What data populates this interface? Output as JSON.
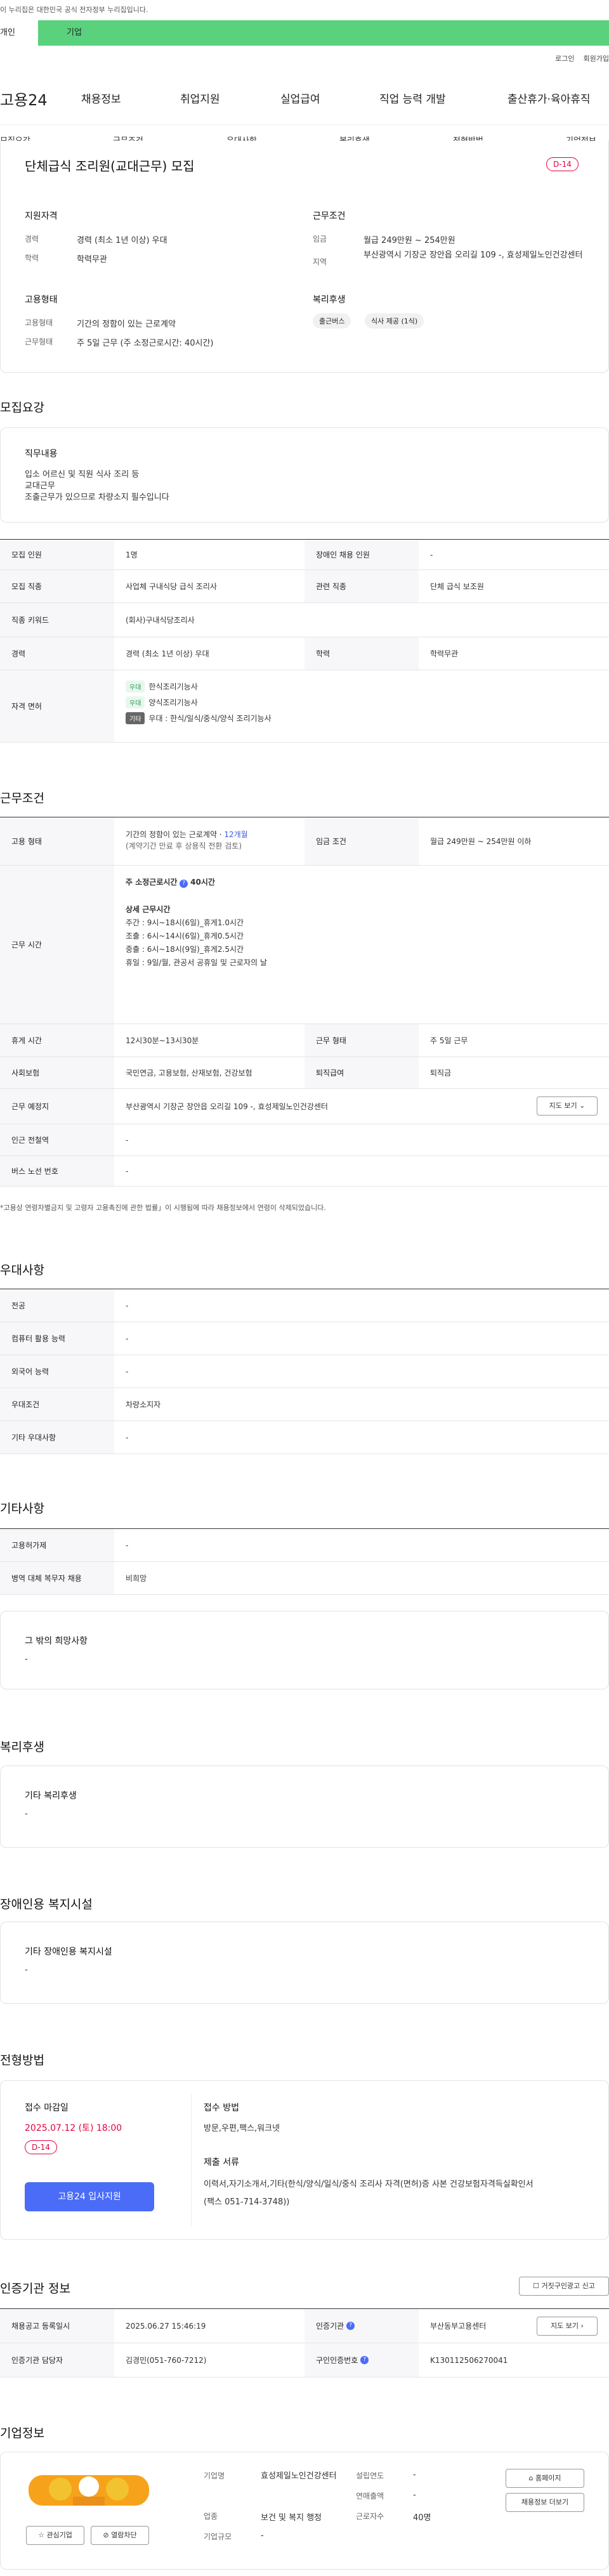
{
  "gov_banner": "이 누리집은 대한민국 공식 전자정부 누리집입니다.",
  "tabs": [
    "개인",
    "기업"
  ],
  "util": [
    "로그인",
    "회원가입"
  ],
  "logo": "고용24",
  "gnb": [
    "채용정보",
    "취업지원",
    "실업급여",
    "직업 능력 개발",
    "출산휴가·육아휴직"
  ],
  "subnav": [
    "모집요강",
    "근무조건",
    "우대사항",
    "복리후생",
    "전형방법",
    "기업정보"
  ],
  "summary": {
    "title": "단체급식 조리원(교대근무) 모집",
    "dday": "D-14",
    "qual_head": "지원자격",
    "career_lbl": "경력",
    "career": "경력 (최소 1년 이상) 우대",
    "edu_lbl": "학력",
    "edu": "학력무관",
    "cond_head": "근무조건",
    "wage_lbl": "임금",
    "wage": "월급 249만원 ~ 254만원",
    "area_lbl": "지역",
    "area": "부산광역시 기장군 장안읍 오리길 109 -, 효성제일노인건강센터",
    "emp_head": "고용형태",
    "emptype_lbl": "고용형태",
    "emptype": "기간의 정함이 있는 근로계약",
    "worktype_lbl": "근무형태",
    "worktype": "주 5일 근무 (주 소정근로시간: 40시간)",
    "welfare_head": "복리후생",
    "welfare_tags": [
      "출근버스",
      "식사 제공 (1식)"
    ]
  },
  "recruit": {
    "title": "모집요강",
    "duty_head": "직무내용",
    "duty": [
      "입소 어르신 및 직원 식사 조리 등",
      "교대근무",
      "조출근무가 있으므로 차량소지 필수입니다"
    ],
    "t_count_lbl": "모집 인원",
    "t_count": "1명",
    "t_dis_lbl": "장애인 채용 인원",
    "t_dis": "-",
    "t_job_lbl": "모집 직종",
    "t_job": "사업체 구내식당 급식 조리사",
    "t_rel_lbl": "관련 직종",
    "t_rel": "단체 급식 보조원",
    "t_kw_lbl": "직종 키워드",
    "t_kw": "(회사)구내식당조리사",
    "t_car_lbl": "경력",
    "t_car": "경력 (최소 1년 이상) 우대",
    "t_edu_lbl": "학력",
    "t_edu": "학력무관",
    "t_lic_lbl": "자격 면허",
    "lic": [
      {
        "tag": "우대",
        "name": "한식조리기능사"
      },
      {
        "tag": "우대",
        "name": "양식조리기능사"
      },
      {
        "tag": "기타",
        "name": "우대 : 한식/일식/중식/양식 조리기능사"
      }
    ]
  },
  "work": {
    "title": "근무조건",
    "emp_lbl": "고용 형태",
    "emp1": "기간의 정함이 있는 근로계약 · ",
    "emp1b": "12개월",
    "emp2": "(계약기간 만료 후 상용직 전환 검토)",
    "wage_lbl": "임금 조건",
    "wage": "월급 249만원 ~ 254만원 이하",
    "time_lbl": "근무 시간",
    "hours_a": "주 소정근로시간",
    "hours_b": "40시간",
    "detail_head": "상세 근무시간",
    "detail": [
      "주간 : 9시~18시(6일)_휴게1.0시간",
      "조출 : 6시~14시(6일)_휴게0.5시간",
      "중출 : 6시~18시(9일)_휴게2.5시간",
      "휴일 : 9일/월,  관공서 공휴일 및 근로자의 날"
    ],
    "rest_lbl": "휴게 시간",
    "rest": "12시30분~13시30분",
    "form_lbl": "근무 형태",
    "form": "주 5일 근무",
    "ins_lbl": "사회보험",
    "ins": "국민연금, 고용보험, 산재보험, 건강보험",
    "ret_lbl": "퇴직급여",
    "ret": "퇴직금",
    "loc_lbl": "근무 예정지",
    "loc": "부산광역시 기장군 장안읍 오리길 109 -, 효성제일노인건강센터",
    "map_btn": "지도 보기",
    "sub_lbl": "인근 전철역",
    "sub": "-",
    "bus_lbl": "버스 노선 번호",
    "bus": "-",
    "note": "*고용상 연령차별금지 및 고령자 고용촉진에 관한 법률」이 시행됨에 따라 채용정보에서 연령이 삭제되었습니다."
  },
  "pref": {
    "title": "우대사항",
    "rows": [
      {
        "l": "전공",
        "v": "-"
      },
      {
        "l": "컴퓨터 활용 능력",
        "v": "-"
      },
      {
        "l": "외국어 능력",
        "v": "-"
      },
      {
        "l": "우대조건",
        "v": "차량소지자"
      },
      {
        "l": "기타 우대사항",
        "v": "-"
      }
    ]
  },
  "etc": {
    "title": "기타사항",
    "rows": [
      {
        "l": "고용허가제",
        "v": "-"
      },
      {
        "l": "병역 대체 복무자 채용",
        "v": "비희망"
      }
    ],
    "other_head": "그 밖의 희망사항",
    "other": "-"
  },
  "welfare": {
    "title": "복리후생",
    "head": "기타 복리후생",
    "val": "-"
  },
  "disab": {
    "title": "장애인용 복지시설",
    "head": "기타 장애인용 복지시설",
    "val": "-"
  },
  "screen": {
    "title": "전형방법",
    "deadline_head": "접수 마감일",
    "deadline": "2025.07.12 (토) 18:00",
    "dday": "D-14",
    "apply_btn": "고용24 입사지원",
    "method_head": "접수 방법",
    "method": "방문,우편,팩스,워크넷",
    "docs_head": "제출 서류",
    "docs": [
      "이력서,자기소개서,기타(한식/양식/일식/중식 조리사 자격(면허)증 사본 건강보험자격득실확인서",
      "(팩스 051-714-3748))"
    ]
  },
  "cert": {
    "title": "인증기관 정보",
    "fake_btn": "거짓구인광고 신고",
    "reg_lbl": "채용공고 등록일시",
    "reg": "2025.06.27 15:46:19",
    "org_lbl": "인증기관",
    "org": "부산동부고용센터",
    "map_btn": "지도 보기",
    "mgr_lbl": "인증기관 담당자",
    "mgr": "김경민(051-760-7212)",
    "num_lbl": "구인인증번호",
    "num": "K130112506270041"
  },
  "company": {
    "title": "기업정보",
    "fav_btn": "관심기업",
    "block_btn": "열람차단",
    "name_lbl": "기업명",
    "name": "효성제일노인건강센터",
    "ind_lbl": "업종",
    "ind": "보건 및 복지 행정",
    "size_lbl": "기업규모",
    "size": "-",
    "year_lbl": "설립연도",
    "year": "-",
    "sales_lbl": "연매출액",
    "sales": "-",
    "emp_lbl": "근로자수",
    "emp": "40명",
    "home_btn": "홈페이지",
    "jobs_btn": "채용정보 더보기"
  },
  "colors": {
    "accent": "#5ad17d",
    "dday": "#e4003d",
    "apply": "#4a6cf7"
  }
}
